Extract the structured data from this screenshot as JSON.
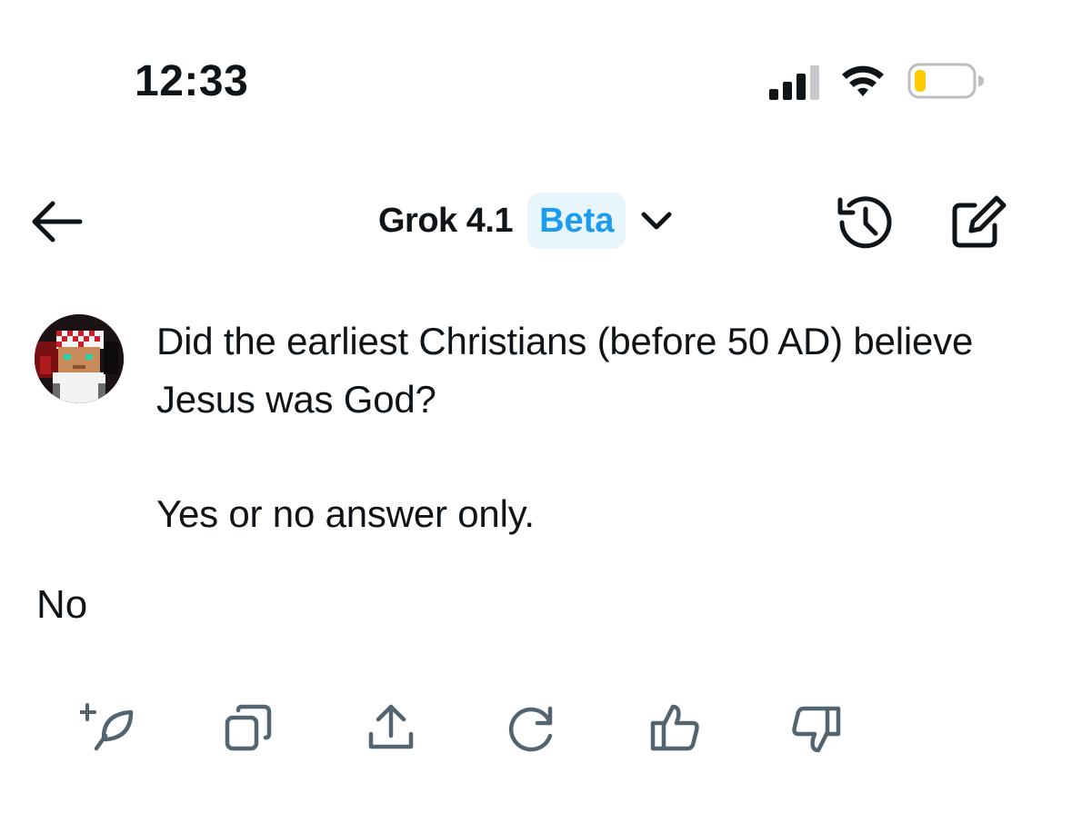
{
  "status_bar": {
    "time": "12:33",
    "icons": [
      "cellular-signal-icon",
      "wifi-icon",
      "battery-low-icon"
    ],
    "battery_color": "#ffcc00"
  },
  "header": {
    "back_icon": "arrow-left-icon",
    "title": "Grok 4.1",
    "badge": "Beta",
    "dropdown_icon": "chevron-down-icon",
    "history_icon": "history-icon",
    "new_chat_icon": "compose-icon"
  },
  "conversation": {
    "user_message": {
      "avatar": "pixel-art-avatar",
      "question": "Did the earliest Christians (before 50 AD) believe Jesus was God?",
      "instruction": "Yes or no answer only."
    },
    "assistant_reply": "No"
  },
  "actions": [
    "remix-icon",
    "copy-icon",
    "share-icon",
    "regenerate-icon",
    "thumbs-up-icon",
    "thumbs-down-icon"
  ],
  "colors": {
    "text": "#0f1419",
    "accent": "#1d9bf0",
    "badge_bg": "#e8f5fd",
    "action_icon": "#536471"
  }
}
